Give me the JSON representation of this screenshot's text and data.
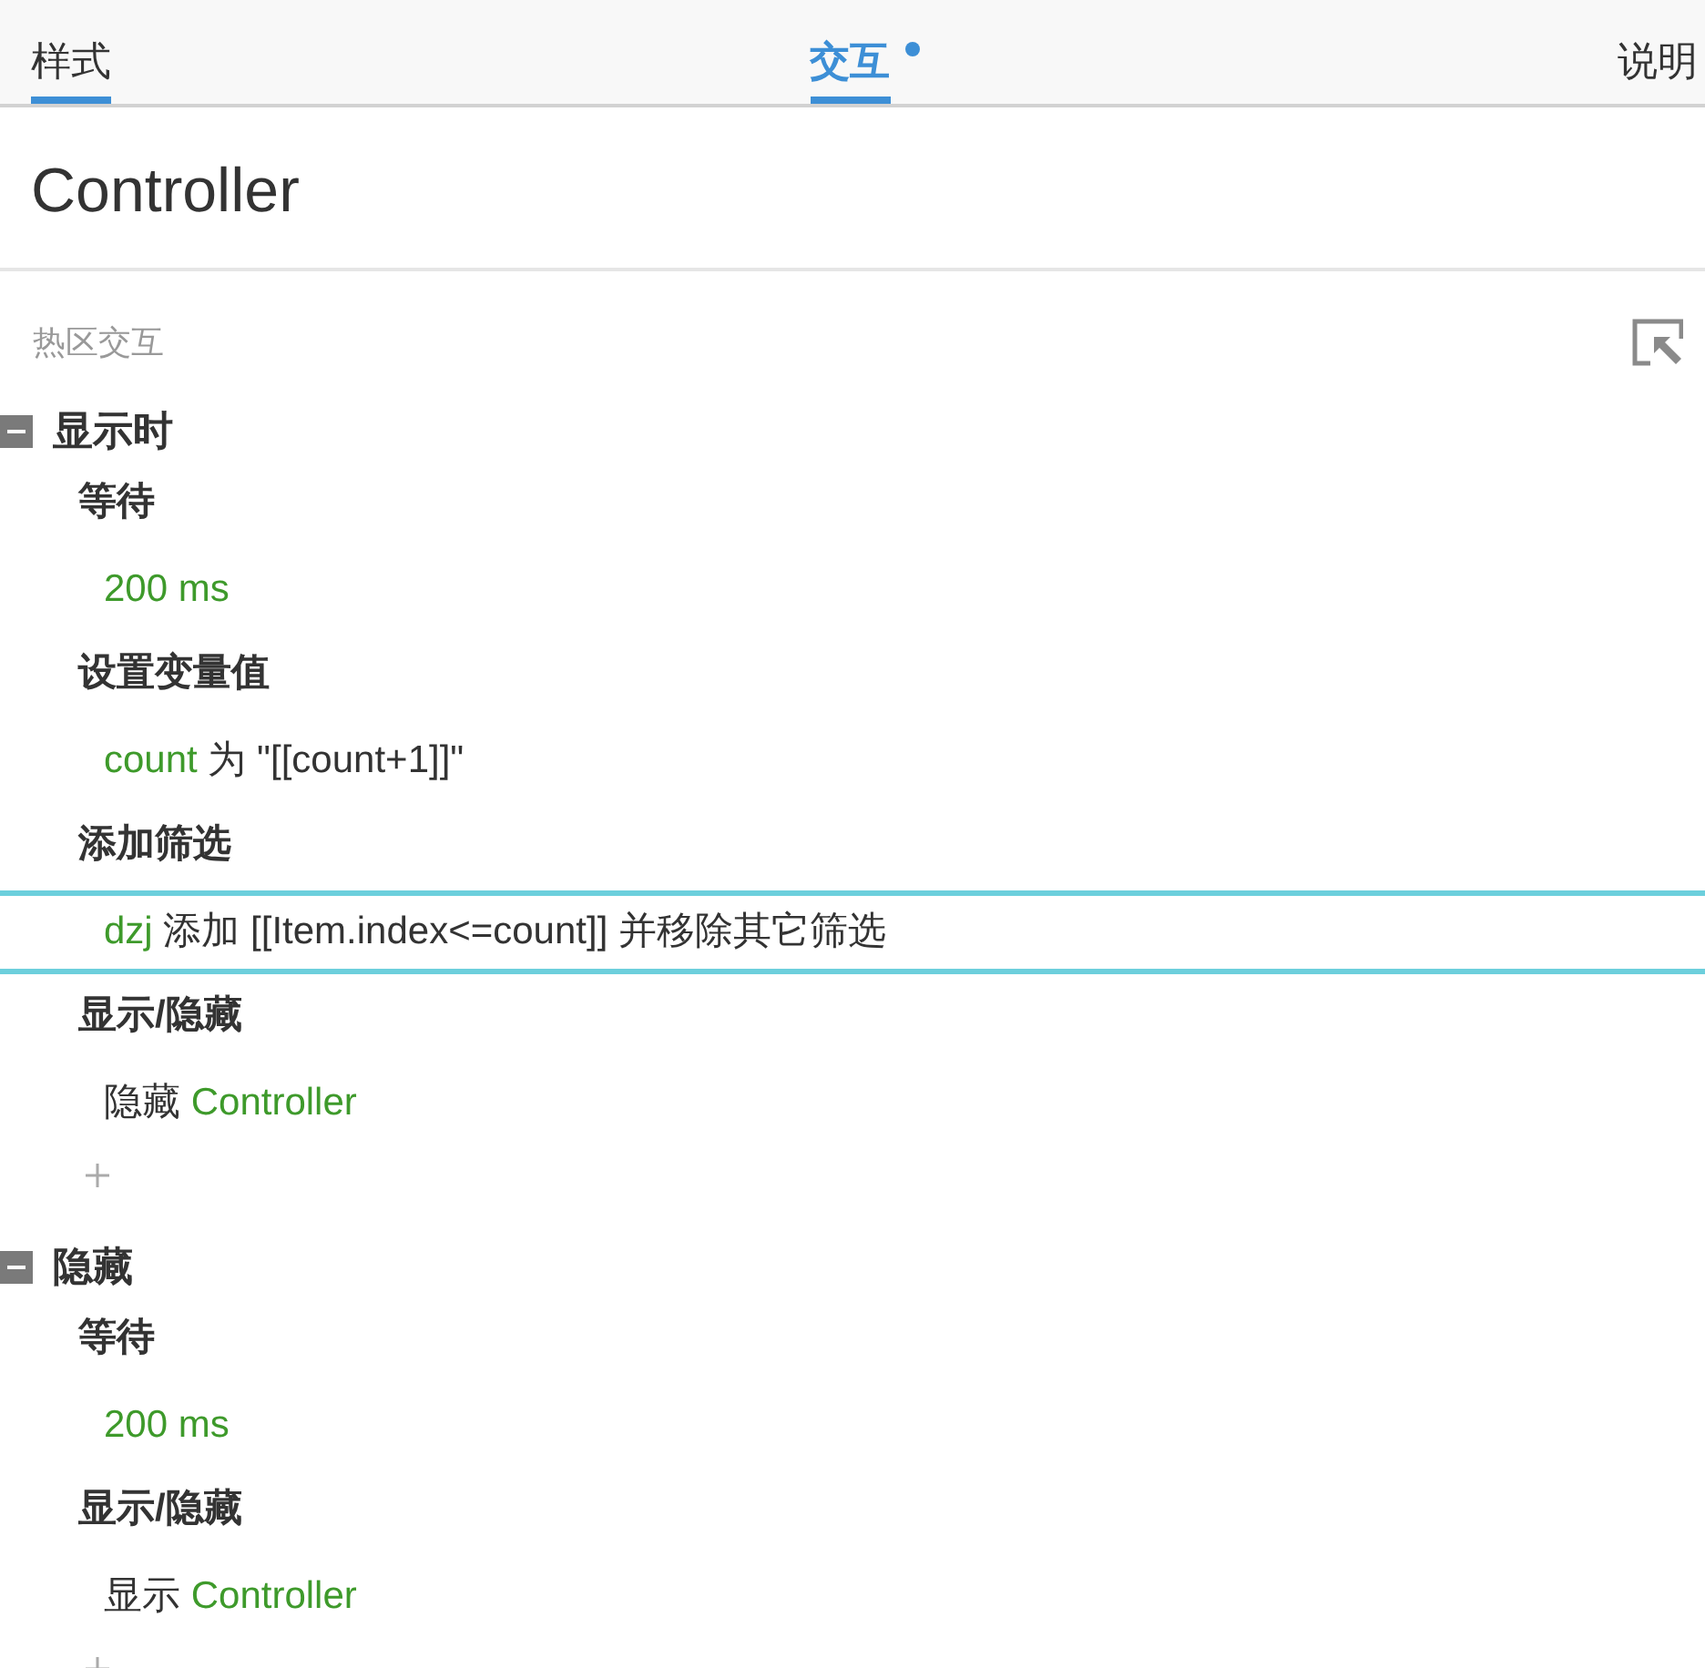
{
  "tabs": [
    {
      "label": "样式",
      "selected": false,
      "underlined": true,
      "modified": false
    },
    {
      "label": "交互",
      "selected": true,
      "underlined": true,
      "modified": true
    },
    {
      "label": "说明",
      "selected": false,
      "underlined": false,
      "modified": false
    }
  ],
  "title": "Controller",
  "section": {
    "title": "热区交互"
  },
  "events": [
    {
      "name": "显示时",
      "expanded": true,
      "actions": [
        {
          "name": "等待",
          "selected": false,
          "detail": [
            {
              "kind": "ref",
              "text": "200 ms"
            }
          ]
        },
        {
          "name": "设置变量值",
          "selected": false,
          "detail": [
            {
              "kind": "ref",
              "text": "count"
            },
            {
              "kind": "text",
              "text": "为 \"[[count+1]]\""
            }
          ]
        },
        {
          "name": "添加筛选",
          "selected": true,
          "detail": [
            {
              "kind": "ref",
              "text": "dzj"
            },
            {
              "kind": "text",
              "text": "添加 [[Item.index<=count]] 并移除其它筛选"
            }
          ]
        },
        {
          "name": "显示/隐藏",
          "selected": false,
          "detail": [
            {
              "kind": "text",
              "text": "隐藏"
            },
            {
              "kind": "ref",
              "text": "Controller"
            }
          ]
        }
      ]
    },
    {
      "name": "隐藏",
      "expanded": true,
      "actions": [
        {
          "name": "等待",
          "selected": false,
          "detail": [
            {
              "kind": "ref",
              "text": "200 ms"
            }
          ]
        },
        {
          "name": "显示/隐藏",
          "selected": false,
          "detail": [
            {
              "kind": "text",
              "text": "显示"
            },
            {
              "kind": "ref",
              "text": "Controller"
            }
          ]
        }
      ]
    }
  ]
}
